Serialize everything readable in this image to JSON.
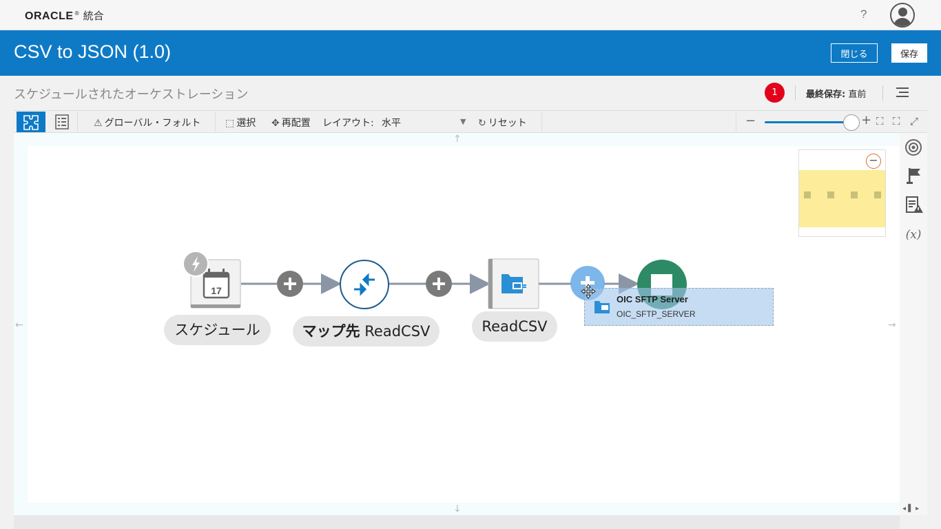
{
  "header": {
    "brand": "ORACLE",
    "registered": "®",
    "product": "統合",
    "help": "?"
  },
  "titlebar": {
    "title": "CSV to JSON (1.0)",
    "close_label": "閉じる",
    "save_label": "保存"
  },
  "subbar": {
    "subtitle": "スケジュールされたオーケストレーション",
    "error_count": "1",
    "last_saved_label": "最終保存:",
    "last_saved_value": "直前"
  },
  "toolbar": {
    "global_fault": "グローバル・フォルト",
    "select": "選択",
    "rearrange": "再配置",
    "layout_label": "レイアウト:",
    "layout_value": "水平",
    "reset": "リセット"
  },
  "flow": {
    "schedule_label": "スケジュール",
    "schedule_date": "17",
    "map_label_bold": "マップ先",
    "map_label_rest": "ReadCSV",
    "read_label": "ReadCSV",
    "drag_title": "OIC SFTP Server",
    "drag_subtitle": "OIC_SFTP_SERVER"
  },
  "colors": {
    "accent": "#0e7ac6",
    "error": "#e3001b",
    "end_node": "#2d8a67",
    "drop_highlight": "#a0c4ea"
  },
  "icons": [
    "puzzle-icon",
    "list-icon",
    "warning-icon",
    "select-icon",
    "move-icon",
    "reset-icon",
    "zoom-out-icon",
    "zoom-in-icon",
    "fit-icon",
    "fit-selection-icon",
    "fullscreen-icon",
    "target-icon",
    "flag-icon",
    "doc-warning-icon",
    "variable-icon",
    "bolt-icon",
    "calendar-icon",
    "mapper-icon",
    "connection-icon",
    "stop-icon",
    "plus-icon"
  ]
}
